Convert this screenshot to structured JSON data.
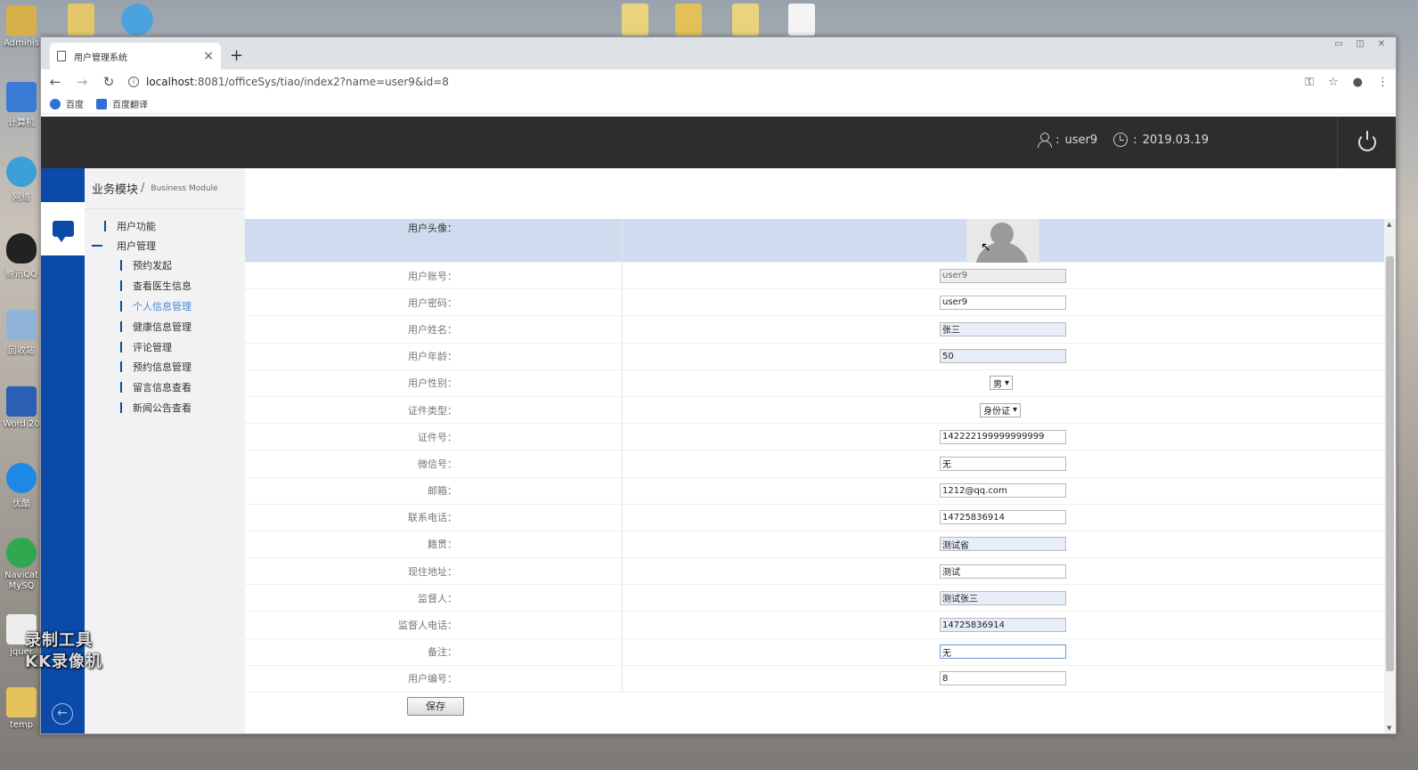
{
  "desktop": {
    "icons": [
      {
        "label": "Adminis",
        "color": "#d8b04a"
      },
      {
        "label": "计算机",
        "color": "#3a7bd5"
      },
      {
        "label": "网络",
        "color": "#3aa0d5"
      },
      {
        "label": "腾讯QQ",
        "color": "#222222"
      },
      {
        "label": "回收站",
        "color": "#8fb4d8"
      },
      {
        "label": "Word 20",
        "color": "#2b5fb4"
      },
      {
        "label": "优酷",
        "color": "#1e88e5"
      },
      {
        "label": "Navicat MySQ",
        "color": "#2fa84f"
      },
      {
        "label": "jquer",
        "color": "#eeeeee"
      },
      {
        "label": "temp",
        "color": "#e6c25a"
      }
    ],
    "watermark_line1": "录制工具",
    "watermark_line2": "KK录像机"
  },
  "browser": {
    "tab_title": "用户管理系统",
    "tab_close": "×",
    "new_tab": "+",
    "url_host": "localhost",
    "url_rest": ":8081/officeSys/tiao/index2?name=user9&id=8",
    "bookmarks": [
      {
        "label": "百度",
        "color": "#2f6fd6"
      },
      {
        "label": "百度翻译",
        "color": "#2f6fd6"
      }
    ]
  },
  "header": {
    "user_sep": ":",
    "username": "user9",
    "date_sep": ":",
    "date": "2019.03.19"
  },
  "sidebar": {
    "breadcrumb_main": "业务模块",
    "breadcrumb_slash": "/",
    "breadcrumb_sub": "Business Module",
    "top_items": [
      "用户功能",
      "用户管理"
    ],
    "sub_items": [
      "预约发起",
      "查看医生信息",
      "个人信息管理",
      "健康信息管理",
      "评论管理",
      "预约信息管理",
      "留言信息查看",
      "新闻公告查看"
    ],
    "active_index": 2
  },
  "form": {
    "avatar_label": "用户头像：",
    "account": {
      "label": "用户账号：",
      "value": "user9"
    },
    "password": {
      "label": "用户密码：",
      "value": "user9"
    },
    "name": {
      "label": "用户姓名：",
      "value": "张三"
    },
    "age": {
      "label": "用户年龄：",
      "value": "50"
    },
    "gender": {
      "label": "用户性别：",
      "value": "男"
    },
    "id_type": {
      "label": "证件类型：",
      "value": "身份证"
    },
    "id_number": {
      "label": "证件号：",
      "value": "142222199999999999"
    },
    "wechat": {
      "label": "微信号：",
      "value": "无"
    },
    "email": {
      "label": "邮箱：",
      "value": "1212@qq.com"
    },
    "phone": {
      "label": "联系电话：",
      "value": "14725836914"
    },
    "origin": {
      "label": "籍贯：",
      "value": "测试省"
    },
    "address": {
      "label": "现住地址：",
      "value": "测试"
    },
    "guardian": {
      "label": "监督人：",
      "value": "测试张三"
    },
    "guardian_phone": {
      "label": "监督人电话：",
      "value": "14725836914"
    },
    "remark": {
      "label": "备注：",
      "value": "无"
    },
    "user_no": {
      "label": "用户编号：",
      "value": "8"
    },
    "save_label": "保存"
  },
  "colors": {
    "header_bg": "#2d2d2d",
    "rail_blue": "#0b4aa8",
    "avatar_row": "#cfdcef",
    "active_menu": "#4a8ad8"
  }
}
